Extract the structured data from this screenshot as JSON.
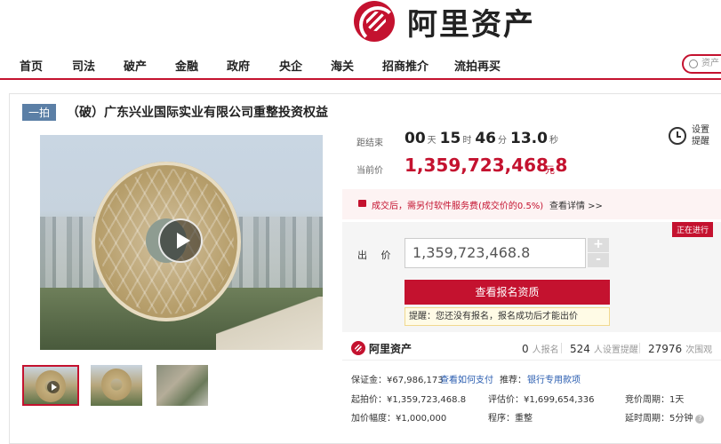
{
  "brand": {
    "name": "阿里资产"
  },
  "nav": {
    "items": [
      "首页",
      "司法",
      "破产",
      "金融",
      "政府",
      "央企",
      "海关",
      "招商推介",
      "流拍再买"
    ],
    "search_placeholder": "资产"
  },
  "item": {
    "tag": "一拍",
    "title": "（破）广东兴业国际实业有限公司重整投资权益"
  },
  "countdown": {
    "label": "距结束",
    "d": "00",
    "d_unit": "天",
    "h": "15",
    "h_unit": "时",
    "m": "46",
    "m_unit": "分",
    "s": "13.0",
    "s_unit": "秒"
  },
  "price": {
    "label": "当前价",
    "value": "1,359,723,468.8",
    "unit": "元"
  },
  "remind": {
    "line1": "设置",
    "line2": "提醒"
  },
  "fee": {
    "text": "成交后，需另付软件服务费(成交价的0.5%)",
    "link": "查看详情 >>"
  },
  "status": "正在进行",
  "bid": {
    "label": "出 价",
    "value": "1,359,723,468.8",
    "plus": "+",
    "minus": "-",
    "button": "查看报名资质",
    "tip": "提醒：您还没有报名，报名成功后才能出价"
  },
  "stats": {
    "signup_count": "0",
    "signup_label": "人报名",
    "remind_count": "524",
    "remind_label": "人设置提醒",
    "view_count": "27976",
    "view_label": "次围观"
  },
  "info": {
    "deposit": "保证金：¥67,986,173",
    "deposit_link": "查看如何支付",
    "recommend_label": "推荐：",
    "recommend_link": "银行专用款项",
    "start_price": "起拍价：¥1,359,723,468.8",
    "eval_price": "评估价：¥1,699,654,336",
    "cycle": "竞价周期：1天",
    "increment": "加价幅度：¥1,000,000",
    "procedure": "程序：重整",
    "delay": "延时周期：5分钟"
  }
}
